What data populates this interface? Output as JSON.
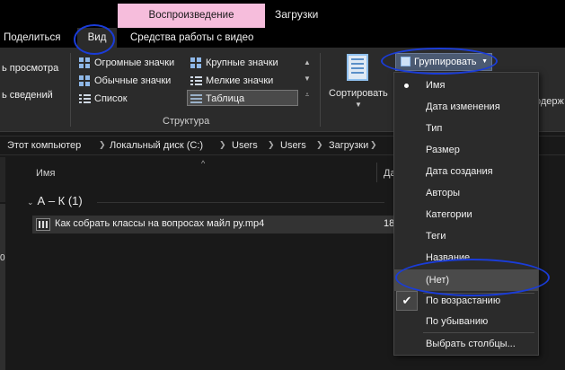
{
  "top": {
    "context_tab": "Воспроизведение",
    "title": "Загрузки"
  },
  "tabs": [
    {
      "label": "Поделиться"
    },
    {
      "label": "Вид"
    },
    {
      "label": "Средства работы с видео"
    }
  ],
  "ribbon": {
    "panes_left": [
      "ь просмотра",
      "ь сведений"
    ],
    "layout_items": [
      {
        "label": "Огромные значки",
        "icon": "extra-large-icons-icon"
      },
      {
        "label": "Крупные значки",
        "icon": "large-icons-icon"
      },
      {
        "label": "Обычные значки",
        "icon": "medium-icons-icon"
      },
      {
        "label": "Мелкие значки",
        "icon": "small-icons-icon"
      },
      {
        "label": "Список",
        "icon": "list-icon"
      },
      {
        "label": "Таблица",
        "icon": "details-icon"
      }
    ],
    "layout_group_label": "Структура",
    "sort_label": "Сортировать",
    "group_by_label": "Группировать",
    "right_cut": "одерж"
  },
  "address": {
    "crumbs": [
      "Этот компьютер",
      "Локальный диск (C:)",
      "Users",
      "Users",
      "Загрузки"
    ]
  },
  "content": {
    "col_name": "Имя",
    "col_date": "Да",
    "group_header": "А – К (1)",
    "file_name": "Как собрать классы на вопросах майл ру.mp4",
    "file_date": "18",
    "left_zero": "0"
  },
  "menu": {
    "items": [
      {
        "label": "Имя",
        "bullet": true
      },
      {
        "label": "Дата изменения"
      },
      {
        "label": "Тип"
      },
      {
        "label": "Размер"
      },
      {
        "label": "Дата создания"
      },
      {
        "label": "Авторы"
      },
      {
        "label": "Категории"
      },
      {
        "label": "Теги"
      },
      {
        "label": "Название"
      },
      {
        "label": "(Нет)",
        "hover": true
      },
      {
        "label": "По возрастанию",
        "checked": true
      },
      {
        "label": "По убыванию"
      },
      {
        "label": "Выбрать столбцы..."
      }
    ]
  },
  "colors": {
    "context_tab_bg": "#f6bddc",
    "annotation": "#1a3cd8",
    "group_by_bg": "#4b5a72"
  }
}
